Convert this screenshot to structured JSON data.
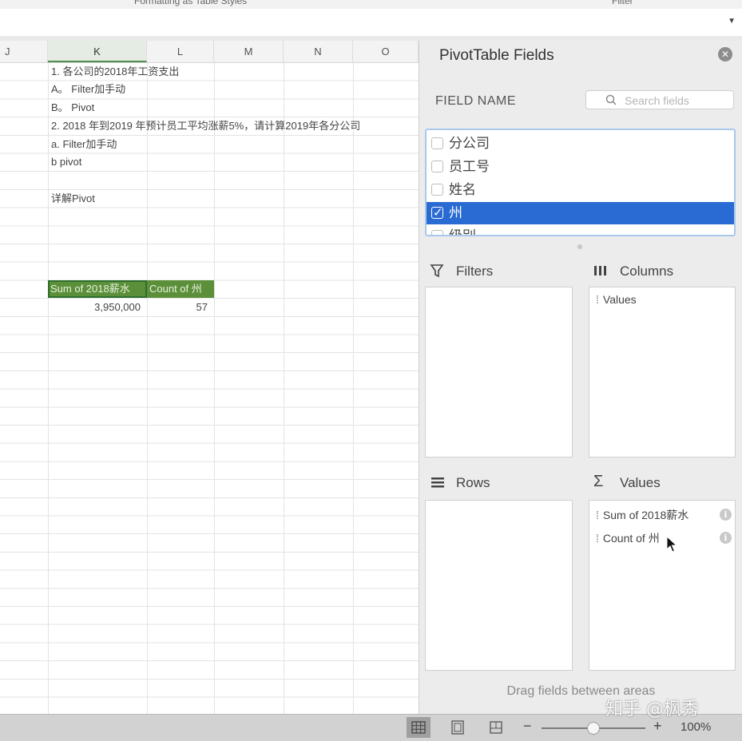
{
  "ribbon": {
    "fragments": [
      "Formatting  as Table    Styles",
      "Filter"
    ]
  },
  "columns": [
    "J",
    "K",
    "L",
    "M",
    "N",
    "O"
  ],
  "active_column": "K",
  "cells": {
    "k1": "1. 各公司的2018年工资支出",
    "k2": "A。 Filter加手动",
    "k3": "B。 Pivot",
    "k4": "2. 2018 年到2019 年预计员工平均涨薪5%，请计算2019年各分公司",
    "k5": "a. Filter加手动",
    "k6": "b pivot",
    "k8": "详解Pivot"
  },
  "pivot_table": {
    "header_sum": "Sum of 2018薪水",
    "header_count": "Count of 州",
    "value_sum": "3,950,000",
    "value_count": "57"
  },
  "panel": {
    "title": "PivotTable Fields",
    "field_name_label": "FIELD NAME",
    "search_placeholder": "Search fields",
    "fields": [
      {
        "label": "分公司",
        "checked": false
      },
      {
        "label": "员工号",
        "checked": false
      },
      {
        "label": "姓名",
        "checked": false
      },
      {
        "label": "州",
        "checked": true
      },
      {
        "label": "级别",
        "checked": false
      }
    ],
    "filters_label": "Filters",
    "columns_label": "Columns",
    "rows_label": "Rows",
    "values_label": "Values",
    "columns_items": [
      "Values"
    ],
    "values_items": [
      "Sum of 2018薪水",
      "Count of 州"
    ],
    "drag_hint": "Drag fields between areas"
  },
  "status_bar": {
    "zoom_minus": "−",
    "zoom_plus": "+",
    "zoom_level": "100%",
    "zoom_fraction": 0.5
  },
  "watermark": "知乎 @枫秀",
  "colors": {
    "pivot_header": "#5c8f3a",
    "selection_blue": "#2a6bd3",
    "panel_bg": "#ececec"
  }
}
